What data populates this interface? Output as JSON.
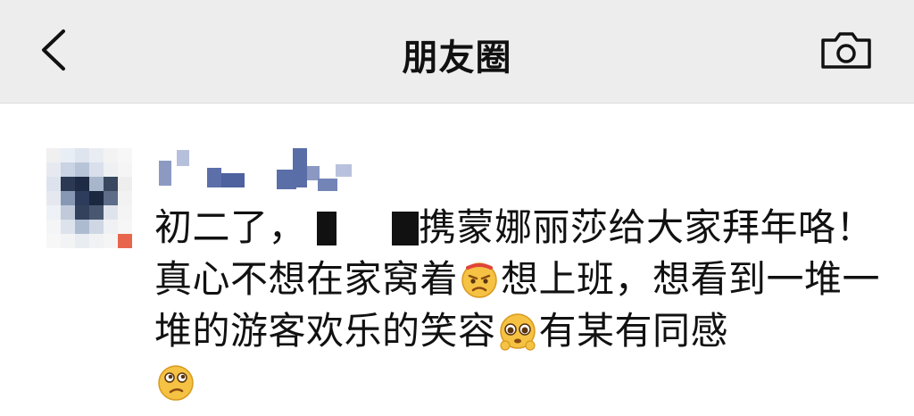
{
  "nav": {
    "title": "朋友圈",
    "back_icon": "chevron-left-icon",
    "camera_icon": "camera-icon"
  },
  "post": {
    "author": "",
    "text_parts": {
      "p1": "初二了，",
      "p2": "携蒙娜丽莎给大家拜年咯！真心不想在家窝着",
      "p3": "想上班，想看到一堆一堆的游客欢乐的笑容",
      "p4": "有某有同感"
    },
    "emojis": [
      "angry-sad-emoji",
      "pleading-emoji",
      "thinking-emoji"
    ]
  },
  "colors": {
    "navbar_bg": "#ededed",
    "text": "#111111",
    "username_blue": "#5a6ea8"
  }
}
